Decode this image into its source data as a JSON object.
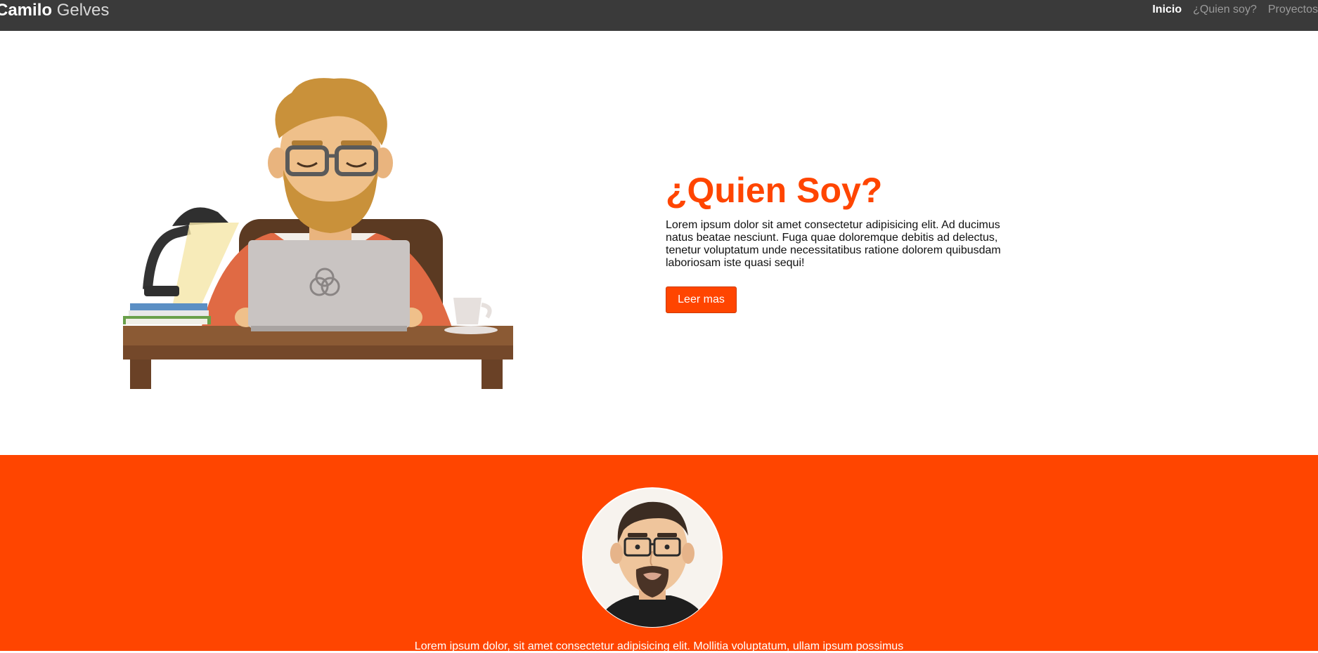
{
  "navbar": {
    "brand_first": "Camilo",
    "brand_last": "Gelves",
    "links": [
      {
        "label": "Inicio",
        "active": true
      },
      {
        "label": "¿Quien soy?",
        "active": false
      },
      {
        "label": "Proyectos",
        "active": false
      }
    ]
  },
  "hero": {
    "title": "¿Quien Soy?",
    "body": "Lorem ipsum dolor sit amet consectetur adipisicing elit. Ad ducimus natus beatae nesciunt. Fuga quae doloremque debitis ad delectus, tenetur voluptatum unde necessitatibus ratione dolorem quibusdam laboriosam iste quasi sequi!",
    "button_label": "Leer mas"
  },
  "about": {
    "text": "Lorem ipsum dolor, sit amet consectetur adipisicing elit. Mollitia voluptatum, ullam ipsum possimus"
  },
  "colors": {
    "accent": "#ff4500",
    "navbar": "#3a3a3a"
  },
  "icons": {
    "illustration": "developer-at-desk-illustration",
    "avatar": "bearded-man-avatar"
  }
}
